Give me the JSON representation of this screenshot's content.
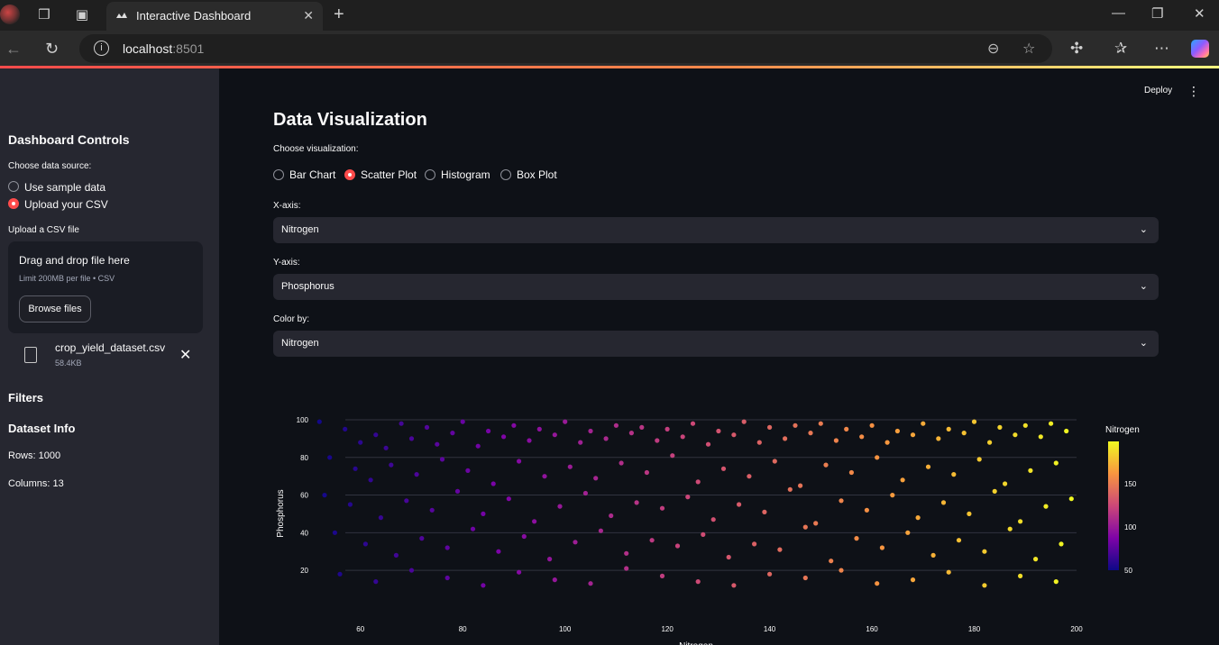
{
  "browser": {
    "tab_title": "Interactive Dashboard",
    "url_host": "localhost",
    "url_port": ":8501"
  },
  "toolbar": {
    "deploy": "Deploy"
  },
  "sidebar": {
    "title": "Dashboard Controls",
    "source_label": "Choose data source:",
    "source_options": [
      "Use sample data",
      "Upload your CSV"
    ],
    "source_selected": "Upload your CSV",
    "upload_label": "Upload a CSV file",
    "drop_title": "Drag and drop file here",
    "drop_limit": "Limit 200MB per file • CSV",
    "browse_label": "Browse files",
    "file_name": "crop_yield_dataset.csv",
    "file_size": "58.4KB",
    "filters_title": "Filters",
    "info_title": "Dataset Info",
    "rows": "Rows: 1000",
    "columns": "Columns: 13"
  },
  "main": {
    "title": "Data Visualization",
    "viz_label": "Choose visualization:",
    "viz_options": [
      "Bar Chart",
      "Scatter Plot",
      "Histogram",
      "Box Plot"
    ],
    "viz_selected": "Scatter Plot",
    "x_label": "X-axis:",
    "x_value": "Nitrogen",
    "y_label": "Y-axis:",
    "y_value": "Phosphorus",
    "color_label": "Color by:",
    "color_value": "Nitrogen"
  },
  "colors": {
    "accent": "#ff4b4b",
    "background": "#0e1117",
    "sidebar": "#262730"
  },
  "chart_data": {
    "type": "scatter",
    "xlabel": "Nitrogen",
    "ylabel": "Phosphorus",
    "xlim": [
      50,
      200
    ],
    "ylim": [
      10,
      100
    ],
    "x_ticks": [
      60,
      80,
      100,
      120,
      140,
      160,
      180,
      200
    ],
    "y_ticks": [
      20,
      40,
      60,
      80,
      100
    ],
    "colorbar": {
      "title": "Nitrogen",
      "ticks": [
        50,
        100,
        150
      ],
      "range": [
        50,
        199
      ],
      "colorscale": "plasma"
    },
    "grid": true,
    "n_points": 1000,
    "x": [
      52,
      57,
      60,
      63,
      65,
      68,
      70,
      73,
      75,
      78,
      80,
      83,
      85,
      88,
      90,
      93,
      95,
      98,
      100,
      103,
      105,
      108,
      110,
      113,
      115,
      118,
      120,
      123,
      125,
      128,
      130,
      133,
      135,
      138,
      140,
      143,
      145,
      148,
      150,
      153,
      155,
      158,
      160,
      163,
      165,
      168,
      170,
      173,
      175,
      178,
      180,
      183,
      185,
      188,
      190,
      193,
      195,
      198,
      54,
      59,
      62,
      66,
      71,
      76,
      81,
      86,
      91,
      96,
      101,
      106,
      111,
      116,
      121,
      126,
      131,
      136,
      141,
      146,
      151,
      156,
      161,
      166,
      171,
      176,
      181,
      186,
      191,
      196,
      53,
      58,
      64,
      69,
      74,
      79,
      84,
      89,
      94,
      99,
      104,
      109,
      114,
      119,
      124,
      129,
      134,
      139,
      144,
      149,
      154,
      159,
      164,
      169,
      174,
      179,
      184,
      189,
      194,
      199,
      55,
      61,
      67,
      72,
      77,
      82,
      87,
      92,
      97,
      102,
      107,
      112,
      117,
      122,
      127,
      132,
      137,
      142,
      147,
      152,
      157,
      162,
      167,
      172,
      177,
      182,
      187,
      192,
      197,
      56,
      63,
      70,
      77,
      84,
      91,
      98,
      105,
      112,
      119,
      126,
      133,
      140,
      147,
      154,
      161,
      168,
      175,
      182,
      189,
      196
    ],
    "y": [
      99,
      95,
      88,
      92,
      85,
      98,
      90,
      96,
      87,
      93,
      99,
      86,
      94,
      91,
      97,
      89,
      95,
      92,
      99,
      88,
      94,
      90,
      97,
      93,
      96,
      89,
      95,
      91,
      98,
      87,
      94,
      92,
      99,
      88,
      96,
      90,
      97,
      93,
      98,
      89,
      95,
      91,
      97,
      88,
      94,
      92,
      98,
      90,
      95,
      93,
      99,
      88,
      96,
      92,
      97,
      91,
      98,
      94,
      80,
      74,
      68,
      76,
      71,
      79,
      73,
      66,
      78,
      70,
      75,
      69,
      77,
      72,
      81,
      67,
      74,
      70,
      78,
      65,
      76,
      72,
      80,
      68,
      75,
      71,
      79,
      66,
      73,
      77,
      60,
      55,
      48,
      57,
      52,
      62,
      50,
      58,
      46,
      54,
      61,
      49,
      56,
      53,
      59,
      47,
      55,
      51,
      63,
      45,
      57,
      52,
      60,
      48,
      56,
      50,
      62,
      46,
      54,
      58,
      40,
      34,
      28,
      37,
      32,
      42,
      30,
      38,
      26,
      35,
      41,
      29,
      36,
      33,
      39,
      27,
      34,
      31,
      43,
      25,
      37,
      32,
      40,
      28,
      36,
      30,
      42,
      26,
      34,
      18,
      14,
      20,
      16,
      12,
      19,
      15,
      13,
      21,
      17,
      14,
      12,
      18,
      16,
      20,
      13,
      15,
      19,
      12,
      17,
      14
    ]
  }
}
